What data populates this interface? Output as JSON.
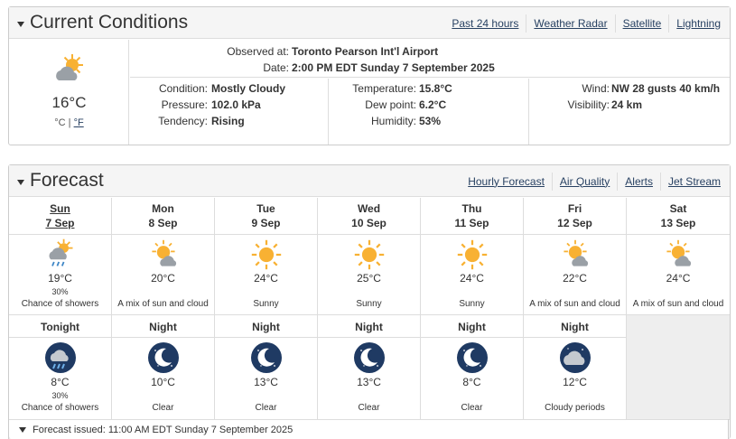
{
  "current": {
    "title": "Current Conditions",
    "links": [
      "Past 24 hours",
      "Weather Radar",
      "Satellite",
      "Lightning"
    ],
    "icon": "sun-cloud-icon",
    "temp": "16°C",
    "unit_c": "°C",
    "unit_sep": "|",
    "unit_f": "°F",
    "observed_label": "Observed at:",
    "observed_value": "Toronto Pearson Int'l Airport",
    "date_label": "Date:",
    "date_value": "2:00 PM EDT Sunday 7 September 2025",
    "condition_label": "Condition:",
    "condition_value": "Mostly Cloudy",
    "pressure_label": "Pressure:",
    "pressure_value": "102.0 kPa",
    "tendency_label": "Tendency:",
    "tendency_value": "Rising",
    "temperature_label": "Temperature:",
    "temperature_value": "15.8°C",
    "dewpoint_label": "Dew point:",
    "dewpoint_value": "6.2°C",
    "humidity_label": "Humidity:",
    "humidity_value": "53%",
    "wind_label": "Wind:",
    "wind_value": "NW 28 gusts 40 km/h",
    "visibility_label": "Visibility:",
    "visibility_value": "24 km"
  },
  "forecast": {
    "title": "Forecast",
    "links": [
      "Hourly Forecast",
      "Air Quality",
      "Alerts",
      "Jet Stream"
    ],
    "days": [
      {
        "day": "Sun",
        "date": "7 Sep",
        "icon": "sun-cloud-rain-icon",
        "temp": "19°C",
        "pop": "30%",
        "summary": "Chance of showers"
      },
      {
        "day": "Mon",
        "date": "8 Sep",
        "icon": "sun-cloud-icon",
        "temp": "20°C",
        "pop": "",
        "summary": "A mix of sun and cloud"
      },
      {
        "day": "Tue",
        "date": "9 Sep",
        "icon": "sun-icon",
        "temp": "24°C",
        "pop": "",
        "summary": "Sunny"
      },
      {
        "day": "Wed",
        "date": "10 Sep",
        "icon": "sun-icon",
        "temp": "25°C",
        "pop": "",
        "summary": "Sunny"
      },
      {
        "day": "Thu",
        "date": "11 Sep",
        "icon": "sun-icon",
        "temp": "24°C",
        "pop": "",
        "summary": "Sunny"
      },
      {
        "day": "Fri",
        "date": "12 Sep",
        "icon": "sun-cloud-icon",
        "temp": "22°C",
        "pop": "",
        "summary": "A mix of sun and cloud"
      },
      {
        "day": "Sat",
        "date": "13 Sep",
        "icon": "sun-cloud-icon",
        "temp": "24°C",
        "pop": "",
        "summary": "A mix of sun and cloud"
      }
    ],
    "nights": [
      {
        "label": "Tonight",
        "icon": "night-cloud-rain-icon",
        "temp": "8°C",
        "pop": "30%",
        "summary": "Chance of showers"
      },
      {
        "label": "Night",
        "icon": "moon-icon",
        "temp": "10°C",
        "pop": "",
        "summary": "Clear"
      },
      {
        "label": "Night",
        "icon": "moon-icon",
        "temp": "13°C",
        "pop": "",
        "summary": "Clear"
      },
      {
        "label": "Night",
        "icon": "moon-icon",
        "temp": "13°C",
        "pop": "",
        "summary": "Clear"
      },
      {
        "label": "Night",
        "icon": "moon-icon",
        "temp": "8°C",
        "pop": "",
        "summary": "Clear"
      },
      {
        "label": "Night",
        "icon": "night-cloud-icon",
        "temp": "12°C",
        "pop": "",
        "summary": "Cloudy periods"
      }
    ],
    "issued": "Forecast issued: 11:00 AM EDT Sunday 7 September 2025"
  },
  "colors": {
    "sun": "#f8b133",
    "cloud": "#9aa0a6",
    "night": "#1f3a63",
    "rain": "#3d86c6",
    "link": "#284162"
  }
}
